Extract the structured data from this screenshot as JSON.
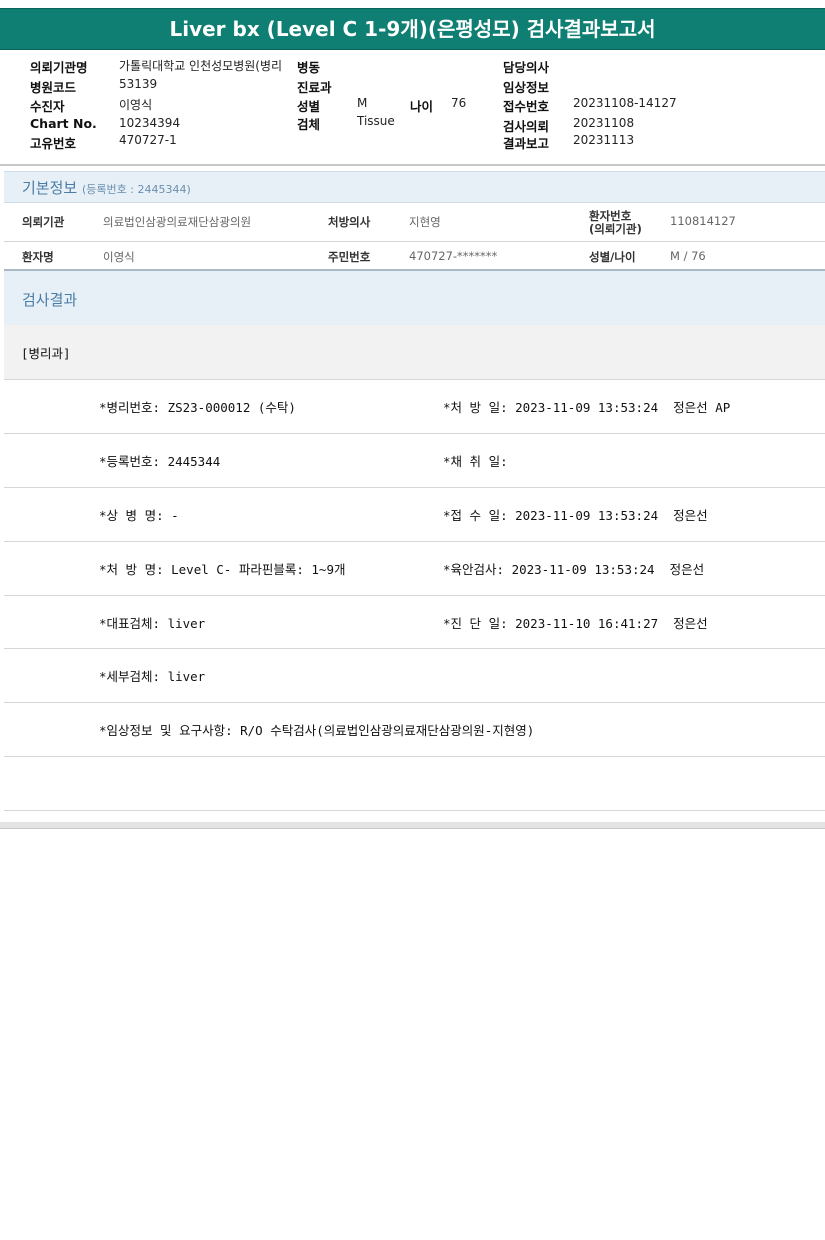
{
  "report": {
    "title": "Liver bx (Level C 1-9개)(은평성모) 검사결과보고서"
  },
  "header": {
    "institution_label": "의뢰기관명",
    "institution_value": "가톨릭대학교 인천성모병원(병리",
    "ward_label": "병동",
    "doctor_label": "담당의사",
    "hospital_code_label": "병원코드",
    "hospital_code_value": "53139",
    "dept_label": "진료과",
    "clinical_label": "임상정보",
    "patient_label": "수진자",
    "patient_value": "이영식",
    "sex_label": "성별",
    "sex_value": "M",
    "age_label": "나이",
    "age_value": "76",
    "receipt_label": "접수번호",
    "receipt_value": "20231108-14127",
    "chart_label": "Chart No.",
    "chart_value": "10234394",
    "specimen_label": "검체",
    "specimen_value": "Tissue",
    "request_label": "검사의뢰",
    "request_value": "20231108",
    "unique_label": "고유번호",
    "unique_value": "470727-1",
    "result_label": "결과보고",
    "result_value": "20231113"
  },
  "basic_info": {
    "title": "기본정보",
    "reg_note": "(등록번호 : 2445344)",
    "inst_label": "의뢰기관",
    "inst_value": "의료법인삼광의료재단삼광의원",
    "prescriber_label": "처방의사",
    "prescriber_value": "지현영",
    "patno_label_1": "환자번호",
    "patno_label_2": "(의뢰기관)",
    "patno_value": "110814127",
    "name_label": "환자명",
    "name_value": "이영식",
    "rrn_label": "주민번호",
    "rrn_value": "470727-*******",
    "sexage_label": "성별/나이",
    "sexage_value": "M / 76"
  },
  "results": {
    "title": "검사결과",
    "dept": "[병리과]",
    "rows": [
      {
        "left": "*병리번호: ZS23-000012 (수탁)",
        "right": "*처 방 일: 2023-11-09 13:53:24  정은선 AP"
      },
      {
        "left": "*등록번호: 2445344",
        "right": "*채 취 일:"
      },
      {
        "left": "*상 병 명: -",
        "right": "*접 수 일: 2023-11-09 13:53:24  정은선"
      },
      {
        "left": "*처 방 명: Level C- 파라핀블록: 1~9개",
        "right": "*육안검사: 2023-11-09 13:53:24  정은선"
      },
      {
        "left": "*대표검체: liver",
        "right": "*진 단 일: 2023-11-10 16:41:27  정은선"
      },
      {
        "left": "*세부검체: liver",
        "right": ""
      },
      {
        "left": "*임상정보 및 요구사항: R/O 수탁검사(의료법인삼광의료재단삼광의원-지현영)",
        "right": ""
      }
    ]
  }
}
